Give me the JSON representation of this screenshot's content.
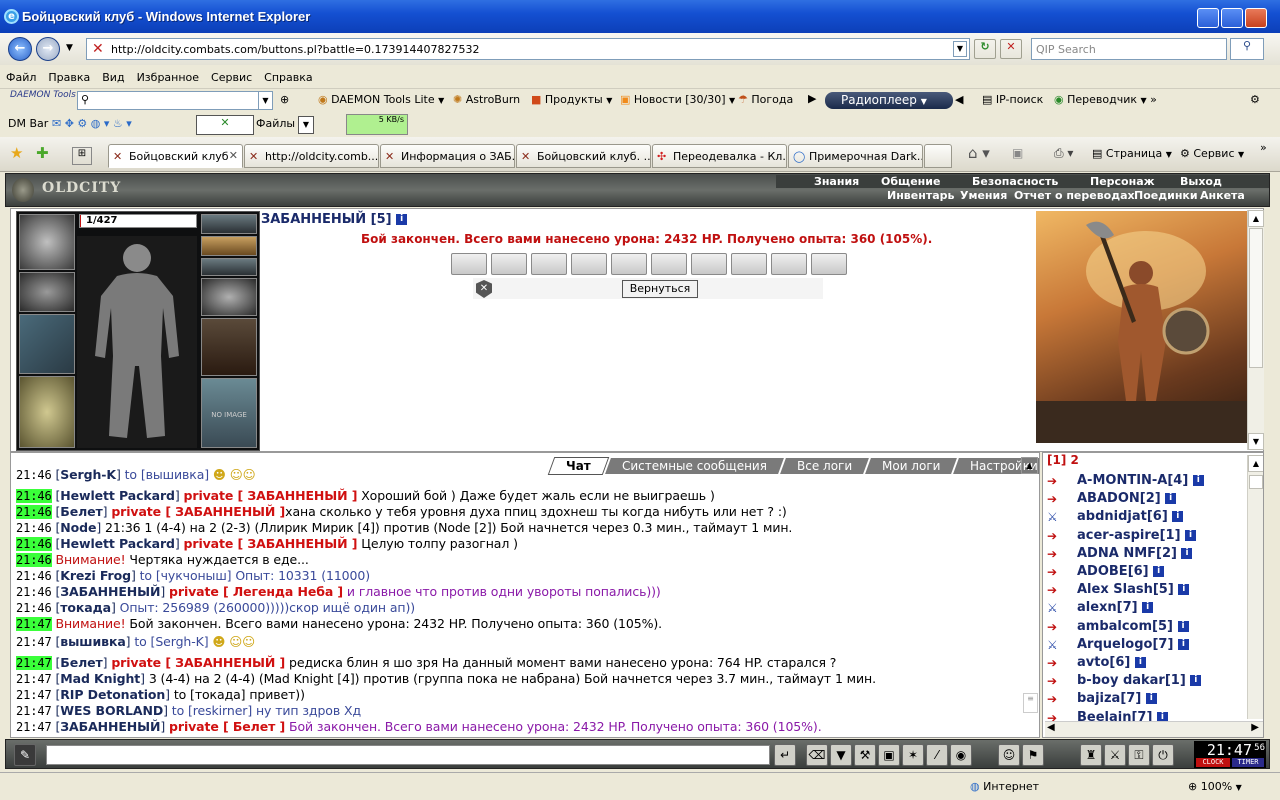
{
  "window": {
    "title": "Бойцовский клуб - Windows Internet Explorer"
  },
  "address": {
    "url": "http://oldcity.combats.com/buttons.pl?battle=0.173914407827532",
    "search_placeholder": "QIP Search"
  },
  "menu": [
    "Файл",
    "Правка",
    "Вид",
    "Избранное",
    "Сервис",
    "Справка"
  ],
  "toolbar1": {
    "daemon": "DAEMON Tools",
    "daemon_lite": "DAEMON Tools Lite",
    "astroburn": "AstroBurn",
    "products": "Продукты",
    "news": "Новости [30/30]",
    "weather": "Погода",
    "radio": "Радиоплеер",
    "ipsearch": "IP-поиск",
    "translator": "Переводчик"
  },
  "toolbar2": {
    "dmbar": "DM Bar",
    "files": "Файлы",
    "speed": "5 KB/s"
  },
  "tabs": [
    {
      "label": "Бойцовский клуб"
    },
    {
      "label": "http://oldcity.comb..."
    },
    {
      "label": "Информация о ЗАБ..."
    },
    {
      "label": "Бойцовский клуб. ..."
    },
    {
      "label": "Переодевалка - Кл..."
    },
    {
      "label": "Примерочная Dark..."
    }
  ],
  "ie_commands": {
    "page": "Страница",
    "service": "Сервис"
  },
  "game": {
    "logo": "OLDCITY",
    "menu_top": [
      "Знания",
      "Общение",
      "Безопасность",
      "Персонаж",
      "Выход"
    ],
    "menu_bottom": [
      "Инвентарь",
      "Умения",
      "Отчет о переводах",
      "Поединки",
      "Анкета"
    ],
    "hp": "1/427",
    "no_image": "NO IMAGE",
    "player_name": "ЗАБАННЕНЫЙ [5]",
    "battle_result": "Бой закончен. Всего вами нанесено урона: 2432 HP. Получено опыта: 360 (105%).",
    "back_button": "Вернуться"
  },
  "chat": {
    "tabs": [
      "Чат",
      "Системные сообщения",
      "Все логи",
      "Мои логи",
      "Настройки"
    ],
    "lines": [
      {
        "time": "21:46",
        "hl": false,
        "nick": "Sergh-K",
        "to": "to [вышивка]",
        "priv": "",
        "text": ""
      },
      {
        "time": "21:46",
        "hl": true,
        "nick": "Hewlett Packard",
        "to": "",
        "priv": "private [ ЗАБАННЕНЫЙ ]",
        "text": " Хороший бой ) Даже будет жаль если не выиграешь )"
      },
      {
        "time": "21:46",
        "hl": true,
        "nick": "Белет",
        "to": "",
        "priv": "private [ ЗАБАННЕНЫЙ ]",
        "text": "хана сколько у тебя уровня духа ппиц здохнеш ты когда нибуть или нет ? :)"
      },
      {
        "time": "21:46",
        "hl": false,
        "nick": "Node",
        "to": "",
        "priv": "",
        "text": " 21:36 1 (4-4) на 2 (2-3) (Ллирик Мирик [4]) против (Node [2]) Бой начнется через 0.3 мин., таймаут 1 мин."
      },
      {
        "time": "21:46",
        "hl": true,
        "nick": "Hewlett Packard",
        "to": "",
        "priv": "private [ ЗАБАННЕНЫЙ ]",
        "text": " Целую толпу разогнал )"
      },
      {
        "time": "21:46",
        "hl": true,
        "nick": "",
        "to": "",
        "priv": "",
        "sys": "Внимание!",
        "text": " Чертяка нуждается в еде..."
      },
      {
        "time": "21:46",
        "hl": false,
        "nick": "Krezi Frog",
        "to": "to [чукчоныш] Опыт: 10331 (11000)",
        "priv": "",
        "text": ""
      },
      {
        "time": "21:46",
        "hl": false,
        "nick": "ЗАБАННЕНЫЙ",
        "to": "",
        "priv": "private [ Легенда Неба ]",
        "text": " и главное что против одни увороты попались)))"
      },
      {
        "time": "21:46",
        "hl": false,
        "nick": "токада",
        "to": "Опыт: 256989 (260000)))))скор ищё один ап))",
        "priv": "",
        "text": ""
      },
      {
        "time": "21:47",
        "hl": true,
        "nick": "",
        "to": "",
        "priv": "",
        "sys": "Внимание!",
        "text": " Бой закончен. Всего вами нанесено урона: 2432 HP. Получено опыта: 360 (105%)."
      },
      {
        "time": "21:47",
        "hl": false,
        "nick": "вышивка",
        "to": "to [Sergh-K]",
        "priv": "",
        "text": ""
      },
      {
        "time": "21:47",
        "hl": true,
        "nick": "Белет",
        "to": "",
        "priv": "private [ ЗАБАННЕНЫЙ ]",
        "text": " редиска блин я шо зря На данный момент вами нанесено урона: 764 HP. старался ?"
      },
      {
        "time": "21:47",
        "hl": false,
        "nick": "Mad Knight",
        "to": "",
        "priv": "",
        "text": " 3 (4-4) на 2 (4-4) (Mad Knight [4]) против (группа пока не набрана) Бой начнется через 3.7 мин., таймаут 1 мин."
      },
      {
        "time": "21:47",
        "hl": false,
        "nick": "RIP Detonation",
        "to": "",
        "priv": "",
        "text": " to [токада] привет))"
      },
      {
        "time": "21:47",
        "hl": false,
        "nick": "WES BORLAND",
        "to": "to [reskirner] ну тип здров Хд",
        "priv": "",
        "text": ""
      },
      {
        "time": "21:47",
        "hl": false,
        "nick": "ЗАБАННЕНЫЙ",
        "to": "",
        "priv": "private [ Белет ]",
        "text": " Бой закончен. Всего вами нанесено урона: 2432 HP. Получено опыта: 360 (105%)."
      }
    ]
  },
  "userlist": {
    "pages": "[1] 2",
    "users": [
      "A-MONTIN-A[4]",
      "ABADON[2]",
      "abdnidjat[6]",
      "acer-aspire[1]",
      "ADNA NMF[2]",
      "ADOBE[6]",
      "Alex Slash[5]",
      "alexn[7]",
      "ambalcom[5]",
      "Arquelogo[7]",
      "avto[6]",
      "b-boy dakar[1]",
      "bajiza[7]",
      "Beelain[7]"
    ]
  },
  "clock": {
    "time": "21:47",
    "seconds": "56",
    "clock_label": "CLOCK",
    "timer_label": "TIMER"
  },
  "status": {
    "zone": "Интернет",
    "zoom": "100%"
  }
}
